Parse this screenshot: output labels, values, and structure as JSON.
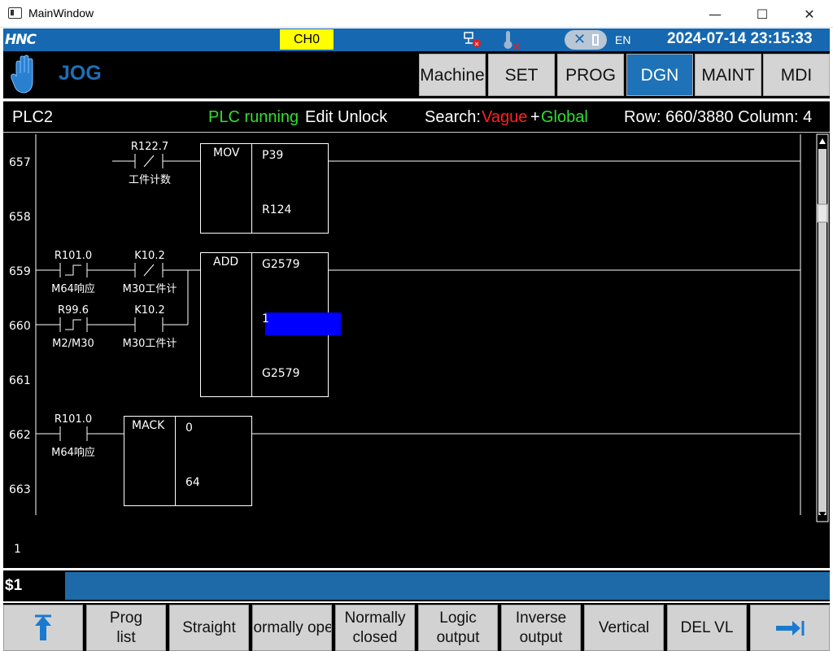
{
  "window": {
    "title": "MainWindow",
    "minimize_glyph": "—",
    "maximize_glyph": "☐",
    "close_glyph": "✕"
  },
  "status": {
    "logo": "HNC",
    "channel": "CH0",
    "language": "EN",
    "datetime": "2024-07-14 23:15:33",
    "channel_color": "#ffff00",
    "bar_color": "#1668b0"
  },
  "mode": {
    "name": "JOG",
    "icon": "hand-icon",
    "tabs": [
      {
        "label": "Machine",
        "active": false
      },
      {
        "label": "SET",
        "active": false
      },
      {
        "label": "PROG",
        "active": false
      },
      {
        "label": "DGN",
        "active": true
      },
      {
        "label": "MAINT",
        "active": false
      },
      {
        "label": "MDI",
        "active": false
      }
    ]
  },
  "info": {
    "plc": "PLC2",
    "running": "PLC running",
    "lock": "Edit Unlock",
    "search_label": "Search:",
    "search_vague": "Vague",
    "search_plus": "+",
    "search_global": "Global",
    "position": "Row: 660/3880 Column: 4"
  },
  "ladder": {
    "rows": [
      "657",
      "658",
      "659",
      "660",
      "661",
      "662",
      "663"
    ],
    "contacts": [
      {
        "addr": "R122.7",
        "comment": "工件计数",
        "kind": "nc"
      },
      {
        "addr": "R101.0",
        "comment": "M64响应",
        "kind": "pulse"
      },
      {
        "addr": "K10.2",
        "comment": "M30工件计",
        "kind": "nc"
      },
      {
        "addr": "R99.6",
        "comment": "M2/M30",
        "kind": "pulse"
      },
      {
        "addr": "K10.2",
        "comment": "M30工件计",
        "kind": "no"
      },
      {
        "addr": "R101.0",
        "comment": "M64响应",
        "kind": "no"
      }
    ],
    "functions": [
      {
        "name": "MOV",
        "params": [
          "P39",
          "R124"
        ]
      },
      {
        "name": "ADD",
        "params": [
          "G2579",
          "1",
          "G2579"
        ]
      },
      {
        "name": "MACK",
        "params": [
          "0",
          "64"
        ]
      }
    ],
    "edit_value": "1",
    "cursor_color": "#0000ff"
  },
  "cmd": {
    "prompt": "$1",
    "value": ""
  },
  "softkeys": [
    {
      "label": "",
      "icon": "page-up-icon"
    },
    {
      "label": "Prog\nlist"
    },
    {
      "label": "Straight"
    },
    {
      "label": "Normally open"
    },
    {
      "label": "Normally\nclosed"
    },
    {
      "label": "Logic\noutput"
    },
    {
      "label": "Inverse\noutput"
    },
    {
      "label": "Vertical"
    },
    {
      "label": "DEL VL"
    },
    {
      "label": "",
      "icon": "next-page-icon"
    }
  ]
}
